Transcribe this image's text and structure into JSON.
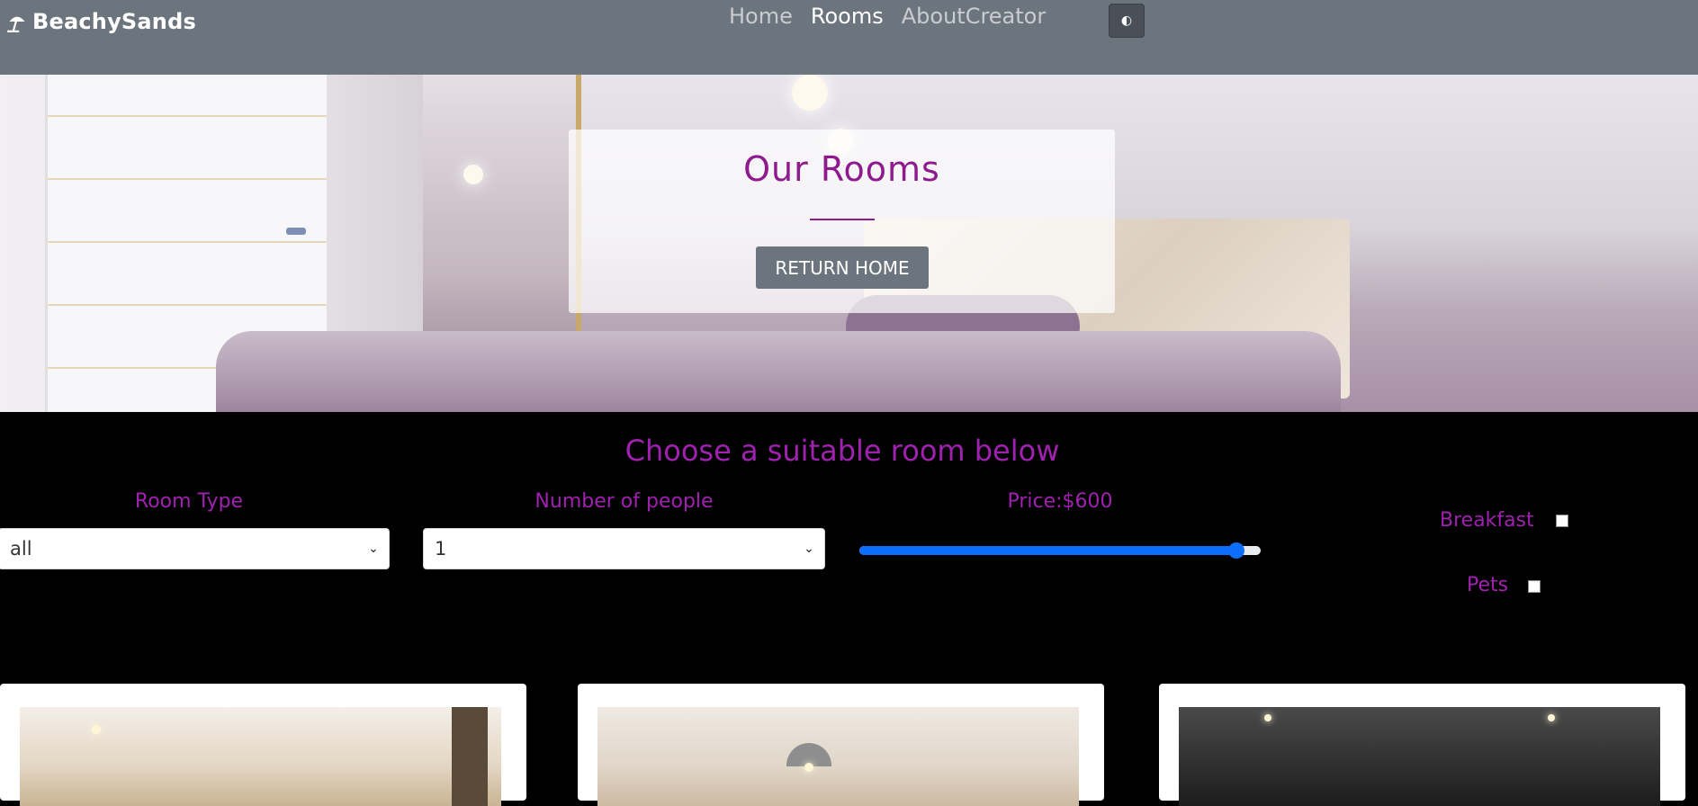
{
  "navbar": {
    "brand_icon": "beach-umbrella-icon",
    "brand": "BeachySands",
    "links": [
      {
        "label": "Home",
        "active": false
      },
      {
        "label": "Rooms",
        "active": true
      },
      {
        "label": "AboutCreator",
        "active": false
      }
    ],
    "theme_toggle_icon": "contrast-icon",
    "theme_toggle_glyph": "◐"
  },
  "hero": {
    "title": "Our Rooms",
    "button_label": "RETURN HOME"
  },
  "filters": {
    "section_title": "Choose a suitable room below",
    "room_type_label": "Room Type",
    "room_type_value": "all",
    "people_label": "Number of people",
    "people_value": "1",
    "price_label": "Price:$600",
    "price_slider_fraction": 0.94,
    "breakfast_label": "Breakfast",
    "breakfast_checked": false,
    "pets_label": "Pets",
    "pets_checked": false
  },
  "rooms": [
    {
      "image": "room-photo"
    },
    {
      "image": "room-photo"
    },
    {
      "image": "room-photo"
    }
  ],
  "colors": {
    "navbar": "#6c757d",
    "accent_purple": "#a020b0",
    "title_purple": "#8e1a8e",
    "slider_blue": "#0d6efd",
    "page_bg": "#000000"
  }
}
